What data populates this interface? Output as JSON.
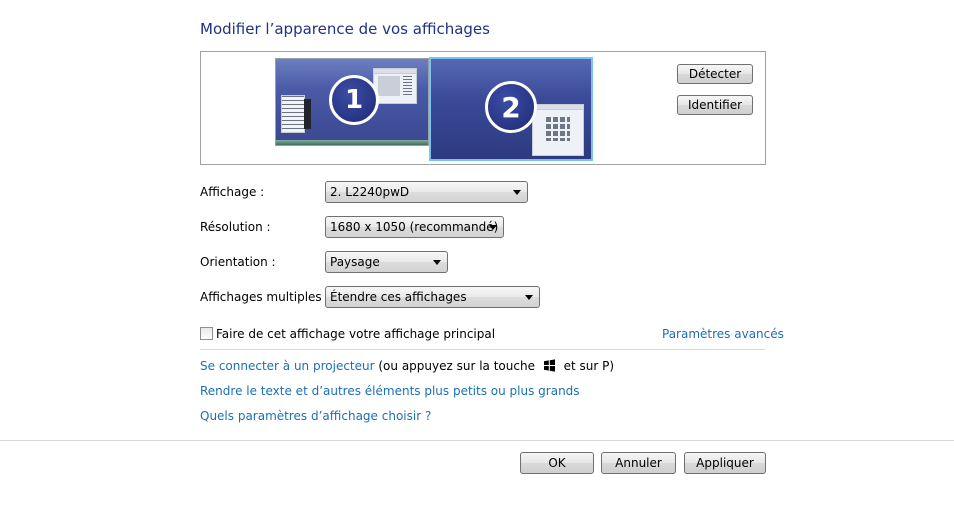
{
  "page": {
    "title": "Modifier l’apparence de vos affichages"
  },
  "preview": {
    "monitor1_number": "1",
    "monitor2_number": "2",
    "detect_label": "Détecter",
    "identify_label": "Identifier"
  },
  "settings": {
    "display_label": "Affichage :",
    "display_value": "2. L2240pwD",
    "resolution_label": "Résolution :",
    "resolution_value": "1680 x 1050 (recommandé)",
    "orientation_label": "Orientation :",
    "orientation_value": "Paysage",
    "multiple_label": "Affichages multiples :",
    "multiple_value": "Étendre ces affichages"
  },
  "primary": {
    "checkbox_label": "Faire de cet affichage votre affichage principal",
    "checked": false,
    "advanced_link": "Paramètres avancés"
  },
  "links": {
    "projector_link": "Se connecter à un projecteur",
    "projector_hint_before": "(ou appuyez sur la touche",
    "projector_hint_after": "et sur P)",
    "text_size_link": "Rendre le texte et d’autres éléments plus petits ou plus grands",
    "which_settings_link": "Quels paramètres d’affichage choisir ?"
  },
  "footer": {
    "ok_label": "OK",
    "cancel_label": "Annuler",
    "apply_label": "Appliquer"
  },
  "colors": {
    "title": "#1e3287",
    "link": "#1c6fb5",
    "selected_monitor_border": "#76c4ef"
  }
}
